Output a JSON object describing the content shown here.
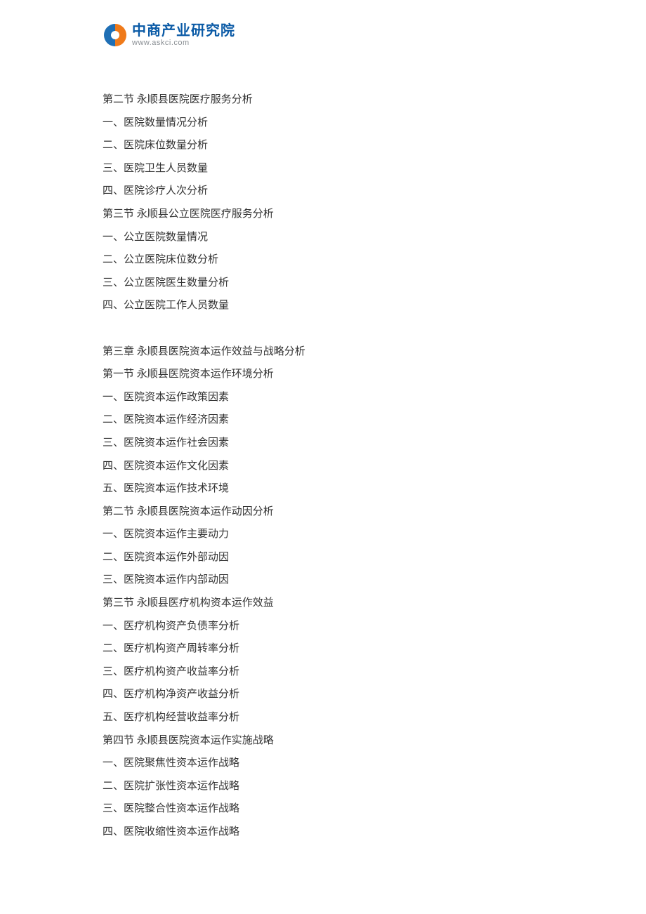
{
  "logo": {
    "cn": "中商产业研究院",
    "en": "www.askci.com"
  },
  "toc": [
    {
      "kind": "line",
      "text": "第二节  永顺县医院医疗服务分析"
    },
    {
      "kind": "line",
      "text": "一、医院数量情况分析"
    },
    {
      "kind": "line",
      "text": "二、医院床位数量分析"
    },
    {
      "kind": "line",
      "text": "三、医院卫生人员数量"
    },
    {
      "kind": "line",
      "text": "四、医院诊疗人次分析"
    },
    {
      "kind": "line",
      "text": "第三节  永顺县公立医院医疗服务分析"
    },
    {
      "kind": "line",
      "text": "一、公立医院数量情况"
    },
    {
      "kind": "line",
      "text": "二、公立医院床位数分析"
    },
    {
      "kind": "line",
      "text": "三、公立医院医生数量分析"
    },
    {
      "kind": "line",
      "text": "四、公立医院工作人员数量"
    },
    {
      "kind": "gap"
    },
    {
      "kind": "line",
      "text": "第三章  永顺县医院资本运作效益与战略分析"
    },
    {
      "kind": "line",
      "text": "第一节  永顺县医院资本运作环境分析"
    },
    {
      "kind": "line",
      "text": "一、医院资本运作政策因素"
    },
    {
      "kind": "line",
      "text": "二、医院资本运作经济因素"
    },
    {
      "kind": "line",
      "text": "三、医院资本运作社会因素"
    },
    {
      "kind": "line",
      "text": "四、医院资本运作文化因素"
    },
    {
      "kind": "line",
      "text": "五、医院资本运作技术环境"
    },
    {
      "kind": "line",
      "text": "第二节  永顺县医院资本运作动因分析"
    },
    {
      "kind": "line",
      "text": "一、医院资本运作主要动力"
    },
    {
      "kind": "line",
      "text": "二、医院资本运作外部动因"
    },
    {
      "kind": "line",
      "text": "三、医院资本运作内部动因"
    },
    {
      "kind": "line",
      "text": "第三节  永顺县医疗机构资本运作效益"
    },
    {
      "kind": "line",
      "text": "一、医疗机构资产负债率分析"
    },
    {
      "kind": "line",
      "text": "二、医疗机构资产周转率分析"
    },
    {
      "kind": "line",
      "text": "三、医疗机构资产收益率分析"
    },
    {
      "kind": "line",
      "text": "四、医疗机构净资产收益分析"
    },
    {
      "kind": "line",
      "text": "五、医疗机构经营收益率分析"
    },
    {
      "kind": "line",
      "text": "第四节  永顺县医院资本运作实施战略"
    },
    {
      "kind": "line",
      "text": "一、医院聚焦性资本运作战略"
    },
    {
      "kind": "line",
      "text": "二、医院扩张性资本运作战略"
    },
    {
      "kind": "line",
      "text": "三、医院整合性资本运作战略"
    },
    {
      "kind": "line",
      "text": "四、医院收缩性资本运作战略"
    }
  ]
}
